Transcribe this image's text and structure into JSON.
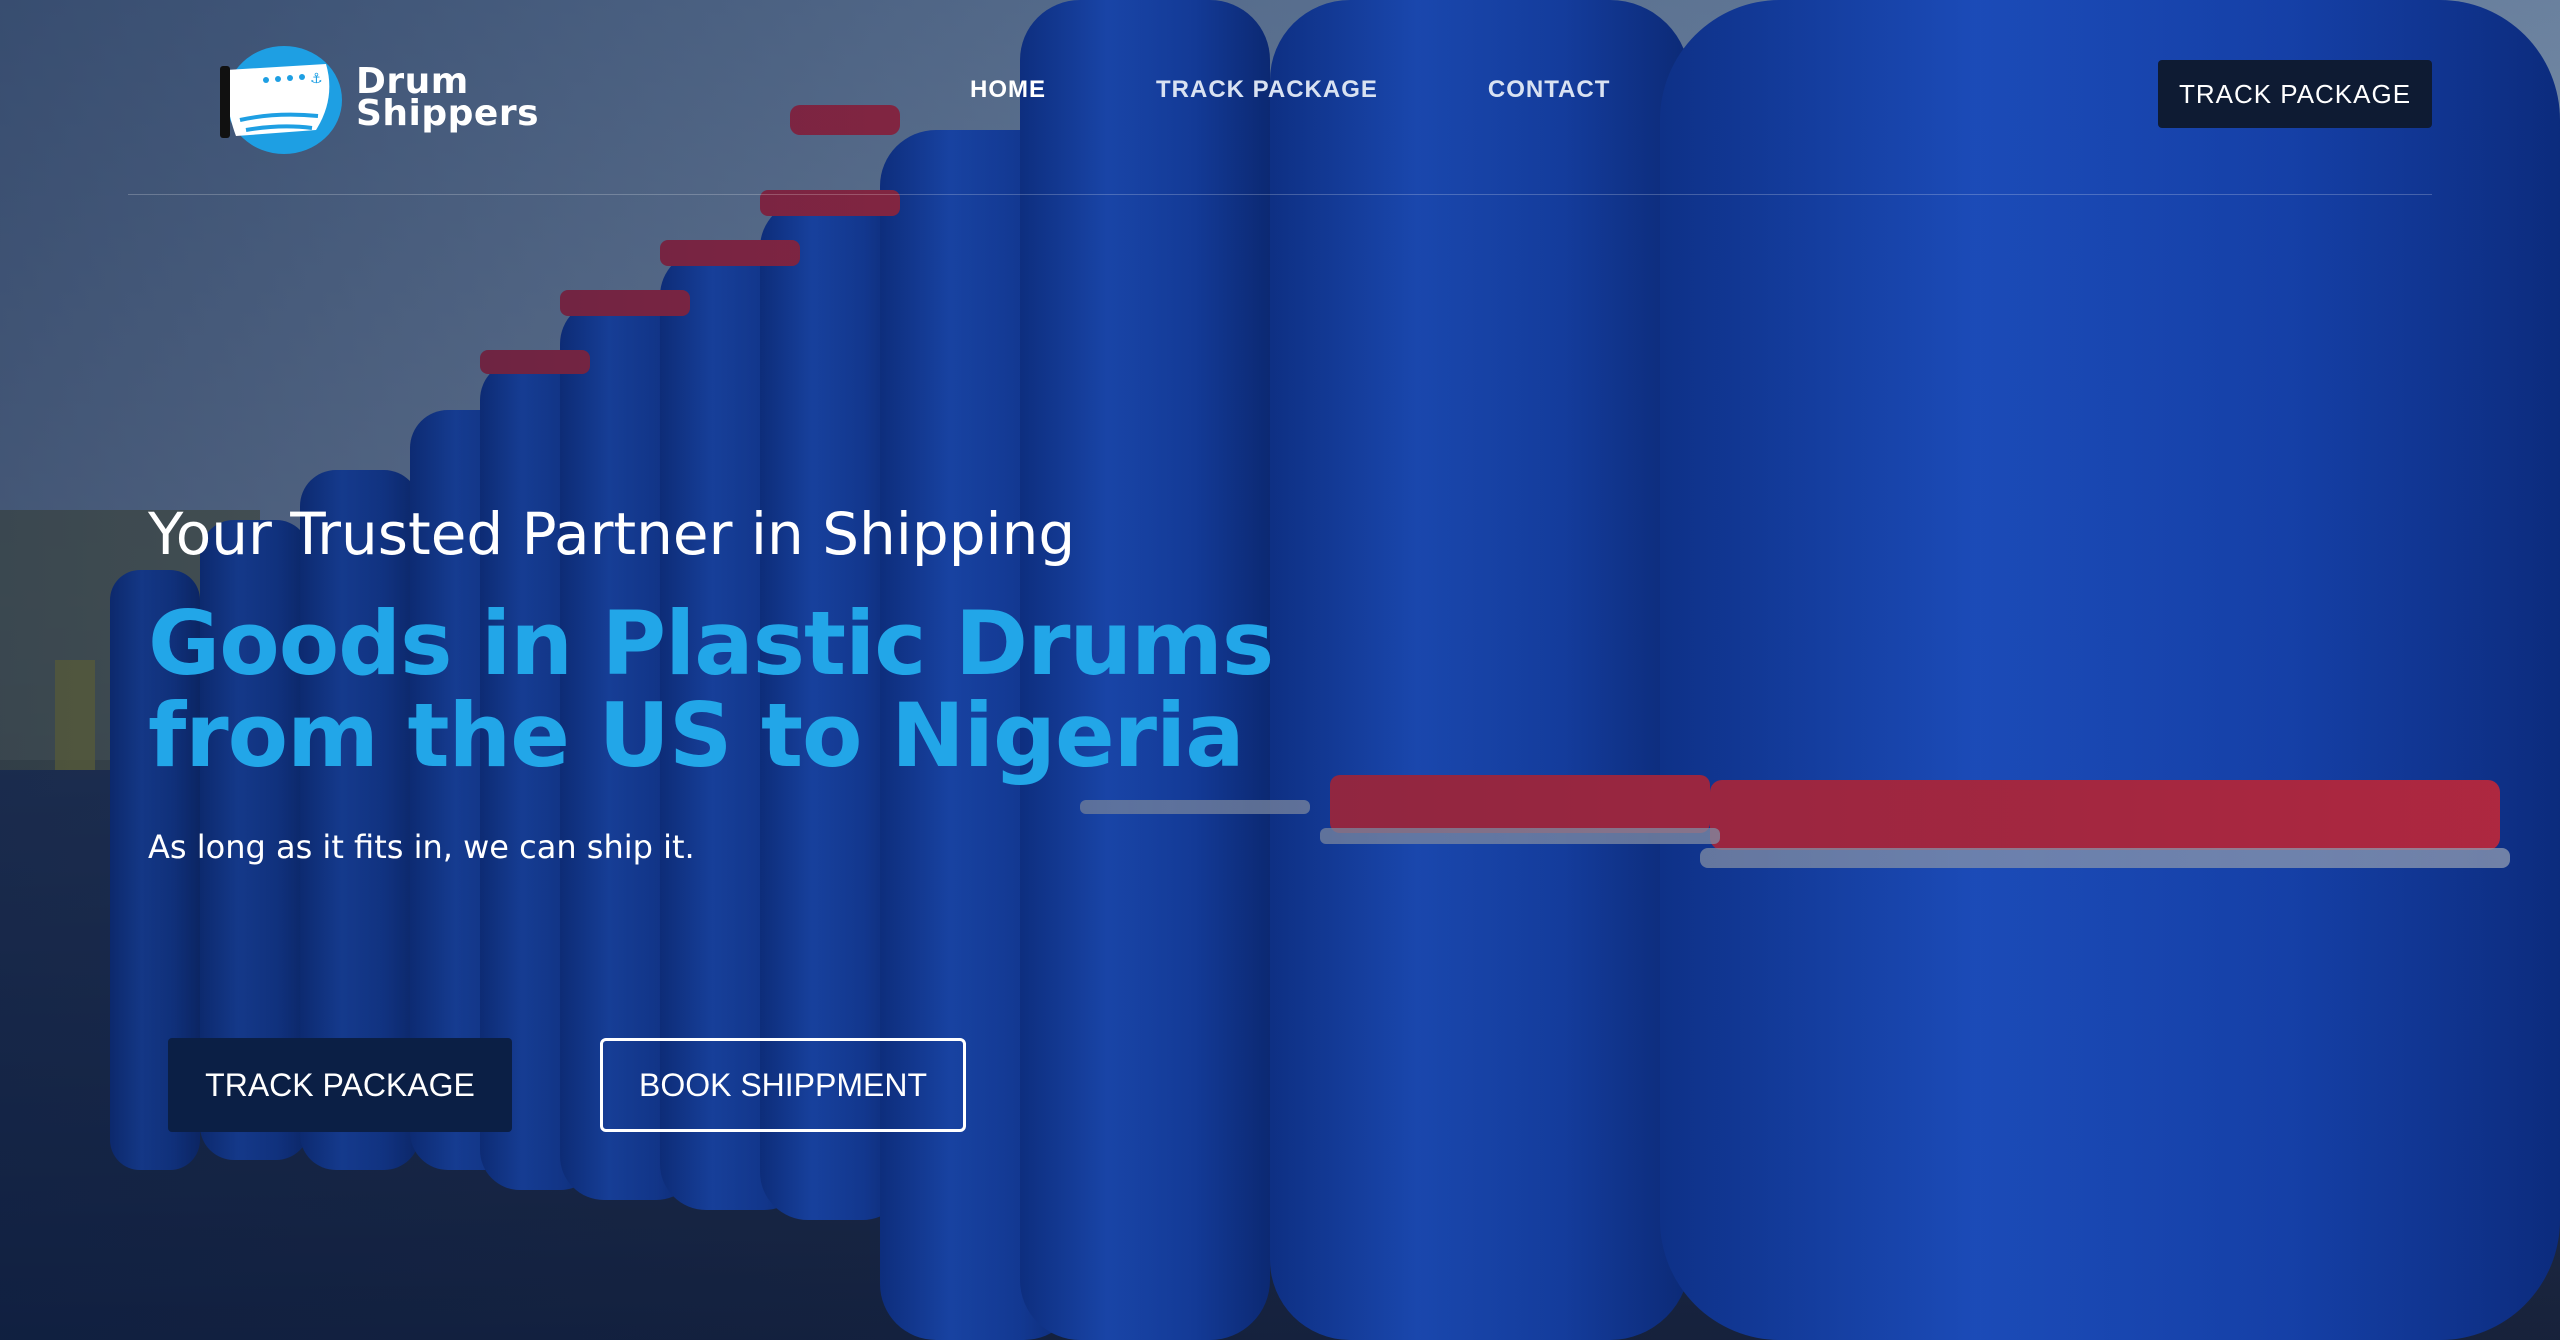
{
  "brand": {
    "line1": "Drum",
    "line2": "Shippers"
  },
  "nav": {
    "items": [
      {
        "label": "HOME",
        "active": true
      },
      {
        "label": "TRACK PACKAGE",
        "active": false
      },
      {
        "label": "CONTACT",
        "active": false
      }
    ],
    "cta_label": "TRACK PACKAGE"
  },
  "hero": {
    "kicker": "Your Trusted Partner in Shipping",
    "title_line1": "Goods in Plastic Drums",
    "title_line2": "from the US to Nigeria",
    "subtitle": "As long as it fits in, we can ship it.",
    "primary_button": "TRACK PACKAGE",
    "secondary_button": "BOOK SHIPPMENT"
  },
  "colors": {
    "accent": "#22a6e8",
    "navy": "#0b1f45",
    "drum_blue": "#1746b8",
    "band_red": "#c8243a"
  }
}
